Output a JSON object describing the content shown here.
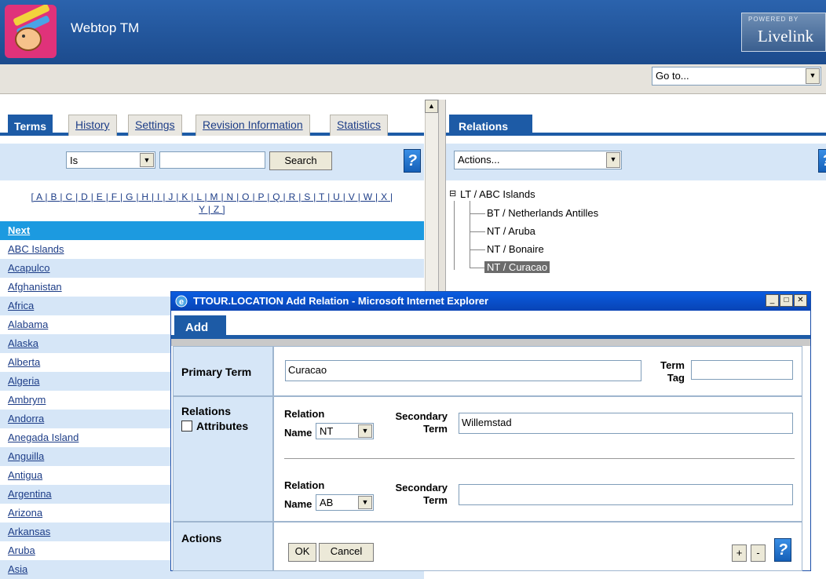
{
  "header": {
    "app_title": "Webtop TM",
    "powered_by": "POWERED BY",
    "brand": "Livelink"
  },
  "toolbar": {
    "goto_value": "Go to..."
  },
  "left_pane": {
    "tabs": [
      "Terms",
      "History",
      "Settings",
      "Revision Information",
      "Statistics"
    ],
    "search": {
      "operator_value": "Is",
      "input_value": "",
      "button_label": "Search",
      "help_label": "?"
    },
    "alphabet_line1": "[ A | B | C | D | E | F | G | H | I | J | K | L | M | N | O | P | Q | R | S | T | U | V | W | X |",
    "alphabet_line2": "Y | Z ]",
    "list_header": "Next",
    "terms": [
      "ABC Islands",
      "Acapulco",
      "Afghanistan",
      "Africa",
      "Alabama",
      "Alaska",
      "Alberta",
      "Algeria",
      "Ambrym",
      "Andorra",
      "Anegada Island",
      "Anguilla",
      "Antigua",
      "Argentina",
      "Arizona",
      "Arkansas",
      "Aruba",
      "Asia"
    ]
  },
  "right_pane": {
    "tab": "Relations",
    "actions_value": "Actions...",
    "help_label": "?",
    "tree": {
      "root_toggle": "⊟",
      "root": "LT / ABC Islands",
      "children": [
        "BT / Netherlands Antilles",
        "NT / Aruba",
        "NT / Bonaire",
        "NT / Curacao"
      ]
    }
  },
  "dialog": {
    "title": "TTOUR.LOCATION Add Relation - Microsoft Internet Explorer",
    "win_buttons": [
      "_",
      "□",
      "✕"
    ],
    "tab": "Add",
    "primary_term_label": "Primary Term",
    "primary_term_value": "Curacao",
    "term_tag_label_1": "Term",
    "term_tag_label_2": "Tag",
    "term_tag_value": "",
    "relations_label": "Relations",
    "attributes_label": "Attributes",
    "relation_rows": [
      {
        "label_1": "Relation",
        "label_2": "Name",
        "name_value": "NT",
        "secondary_label_1": "Secondary",
        "secondary_label_2": "Term",
        "secondary_value": "Willemstad"
      },
      {
        "label_1": "Relation",
        "label_2": "Name",
        "name_value": "AB",
        "secondary_label_1": "Secondary",
        "secondary_label_2": "Term",
        "secondary_value": ""
      }
    ],
    "actions_label": "Actions",
    "ok_label": "OK",
    "cancel_label": "Cancel",
    "plus_label": "+",
    "minus_label": "-",
    "help_label": "?"
  },
  "colors": {
    "header_blue": "#1c4b8d",
    "tab_blue": "#1d5ba6",
    "list_highlight": "#1c9ae0",
    "row_alt": "#d6e6f7",
    "dialog_title": "#0843b5"
  }
}
